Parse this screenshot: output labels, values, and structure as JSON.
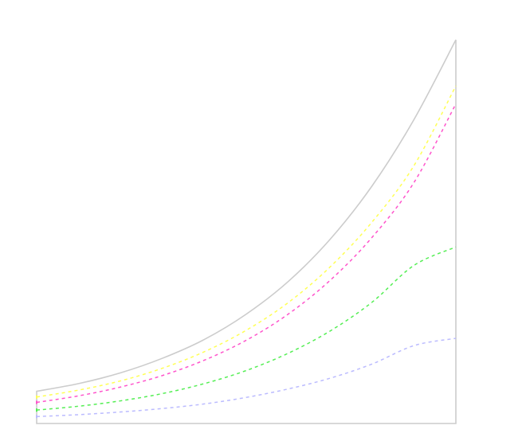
{
  "chart_data": {
    "type": "area",
    "title": "",
    "xlabel": "",
    "ylabel": "",
    "grid": false,
    "legend": "none",
    "xlim": [
      0,
      1
    ],
    "ylim": [
      0,
      1
    ],
    "x": [
      0,
      0.1,
      0.2,
      0.3,
      0.4,
      0.5,
      0.6,
      0.7,
      0.8,
      0.9,
      1.0
    ],
    "series": [
      {
        "style": "area-outline",
        "color": "#cccccc",
        "values": [
          0.084,
          0.104,
          0.132,
          0.17,
          0.219,
          0.285,
          0.37,
          0.48,
          0.619,
          0.792,
          1.0
        ]
      },
      {
        "style": "dashed",
        "color": "#ffff55",
        "values": [
          0.069,
          0.087,
          0.111,
          0.144,
          0.187,
          0.243,
          0.315,
          0.408,
          0.525,
          0.672,
          0.88
        ]
      },
      {
        "style": "dashed",
        "color": "#ff55cc",
        "values": [
          0.055,
          0.072,
          0.095,
          0.125,
          0.165,
          0.217,
          0.285,
          0.373,
          0.485,
          0.628,
          0.833
        ]
      },
      {
        "style": "dashed",
        "color": "#55ee55",
        "values": [
          0.035,
          0.045,
          0.059,
          0.078,
          0.104,
          0.138,
          0.183,
          0.241,
          0.316,
          0.412,
          0.46
        ]
      },
      {
        "style": "dashed",
        "color": "#bbbbff",
        "values": [
          0.018,
          0.023,
          0.03,
          0.039,
          0.051,
          0.068,
          0.09,
          0.118,
          0.155,
          0.203,
          0.222
        ]
      }
    ]
  }
}
